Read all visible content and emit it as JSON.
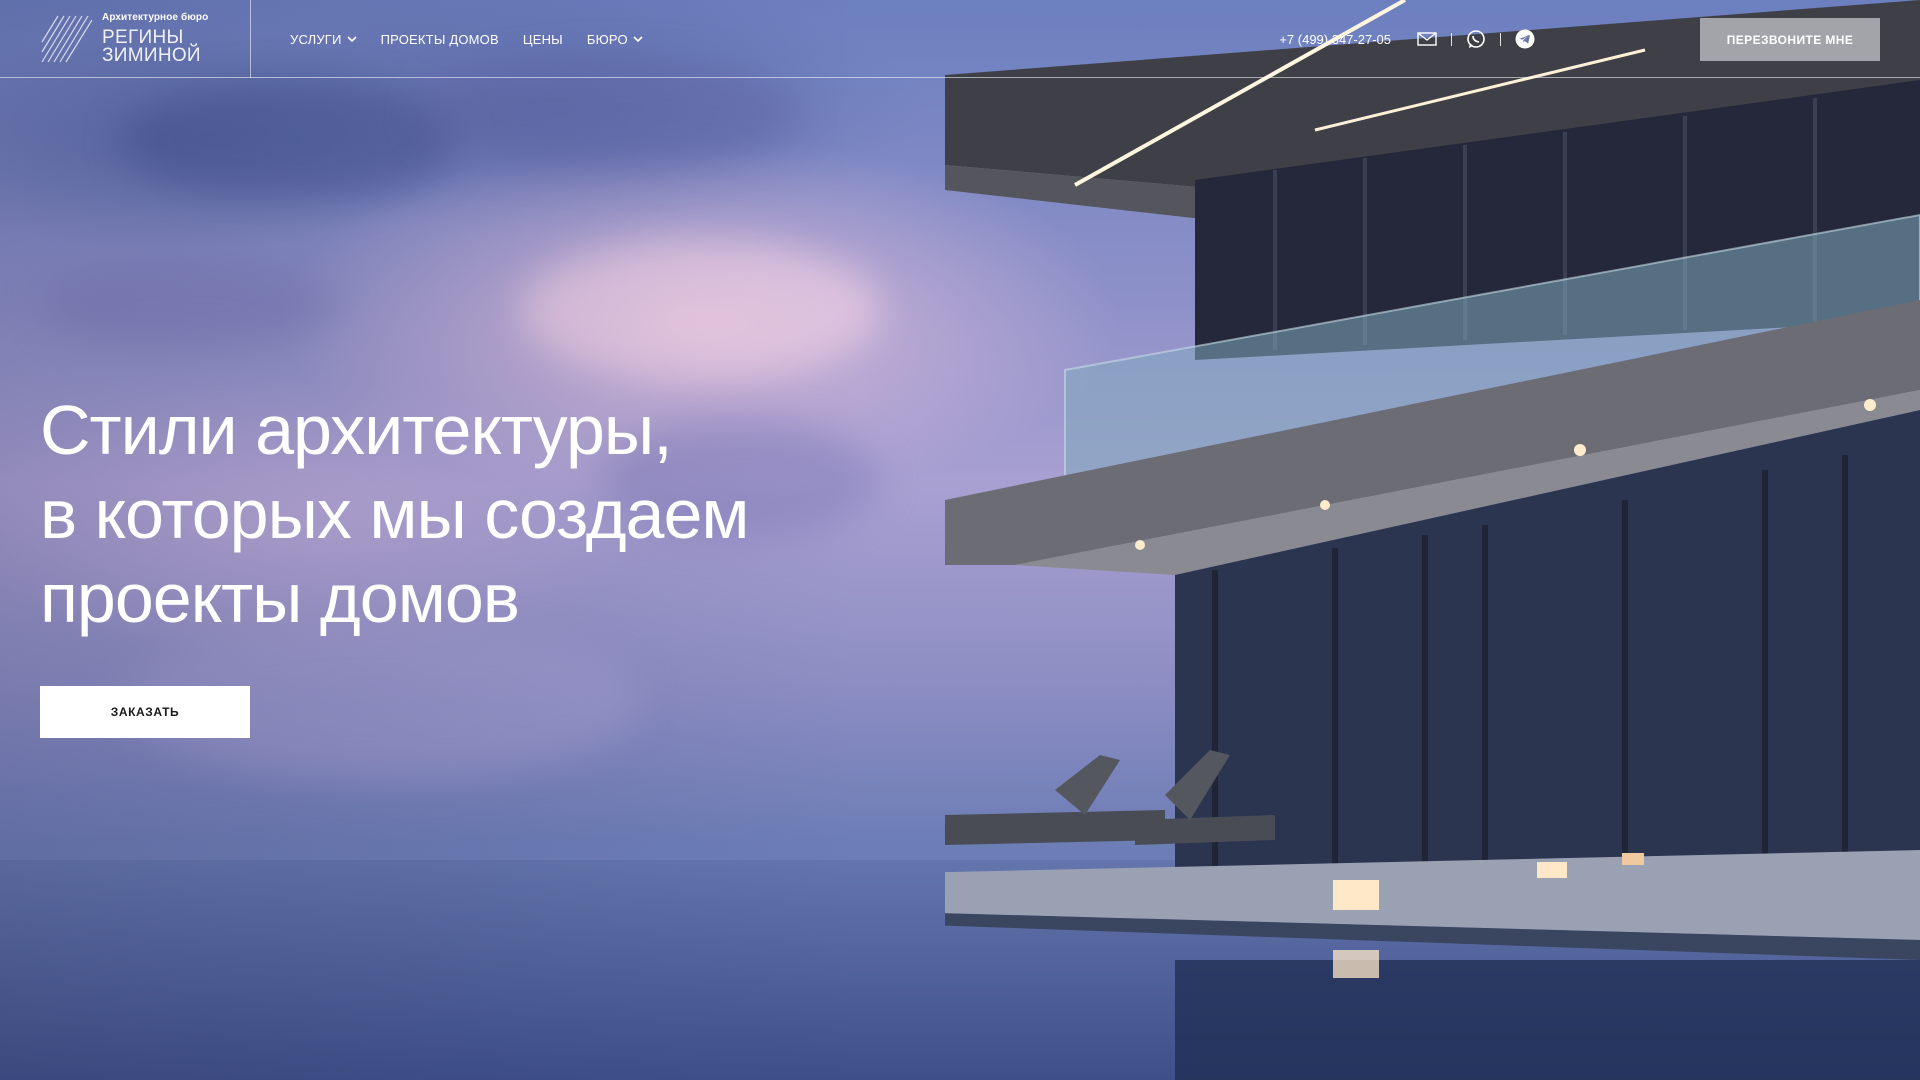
{
  "logo": {
    "subtitle": "Архитектурное бюро",
    "name_line1": "РЕГИНЫ",
    "name_line2": "ЗИМИНОЙ"
  },
  "nav": {
    "items": [
      {
        "label": "УСЛУГИ",
        "has_dropdown": true
      },
      {
        "label": "ПРОЕКТЫ ДОМОВ",
        "has_dropdown": false
      },
      {
        "label": "ЦЕНЫ",
        "has_dropdown": false
      },
      {
        "label": "БЮРО",
        "has_dropdown": true
      }
    ]
  },
  "contacts": {
    "phone": "+7 (499) 347-27-05",
    "icons": [
      "mail-icon",
      "whatsapp-icon",
      "telegram-icon"
    ]
  },
  "header": {
    "callback_label": "ПЕРЕЗВОНИТЕ МНЕ"
  },
  "hero": {
    "title_lines": [
      "Стили архитектуры,",
      "в которых мы создаем",
      "проекты домов"
    ],
    "cta_label": "ЗАКАЗАТЬ"
  },
  "colors": {
    "sky_top": "#6c7fbf",
    "sky_pink": "#ecc4de",
    "button_primary_bg": "#ffffff",
    "button_secondary_bg": "#aaacb2"
  }
}
